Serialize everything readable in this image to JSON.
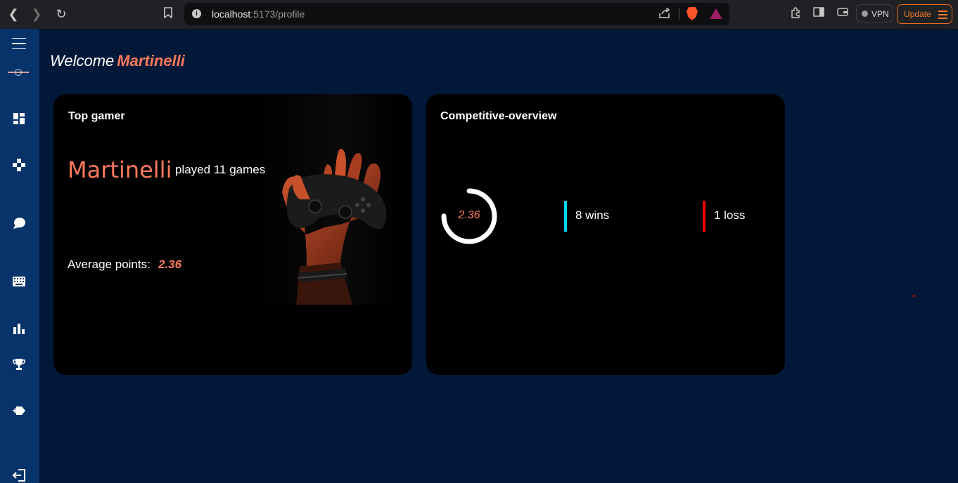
{
  "browser": {
    "url_host": "localhost",
    "url_path": ":5173/profile",
    "vpn_label": "VPN",
    "update_label": "Update"
  },
  "sidebar": {
    "items": [
      {
        "icon": "menu-icon"
      },
      {
        "icon": "app-logo"
      },
      {
        "icon": "dashboard-icon"
      },
      {
        "icon": "gamepad-icon"
      },
      {
        "icon": "chat-icon"
      },
      {
        "icon": "keyboard-icon"
      },
      {
        "icon": "bar-chart-icon"
      },
      {
        "icon": "trophy-icon"
      },
      {
        "icon": "add-game-icon"
      },
      {
        "icon": "logout-icon"
      }
    ]
  },
  "header": {
    "welcome": "Welcome",
    "username": "Martinelli"
  },
  "top_gamer": {
    "title": "Top gamer",
    "name": "Martinelli",
    "played": "played 11 games",
    "average_label": "Average points:",
    "average_value": "2.36"
  },
  "competitive": {
    "title": "Competitive-overview",
    "gauge_value": "2.36",
    "gauge_fraction": 0.75,
    "wins": "8 wins",
    "losses": "1 loss"
  },
  "colors": {
    "accent": "#ff7a5c",
    "wins": "#00d5ee",
    "loss": "#ff0000",
    "sidebar": "#06336a",
    "background": "#021838"
  }
}
